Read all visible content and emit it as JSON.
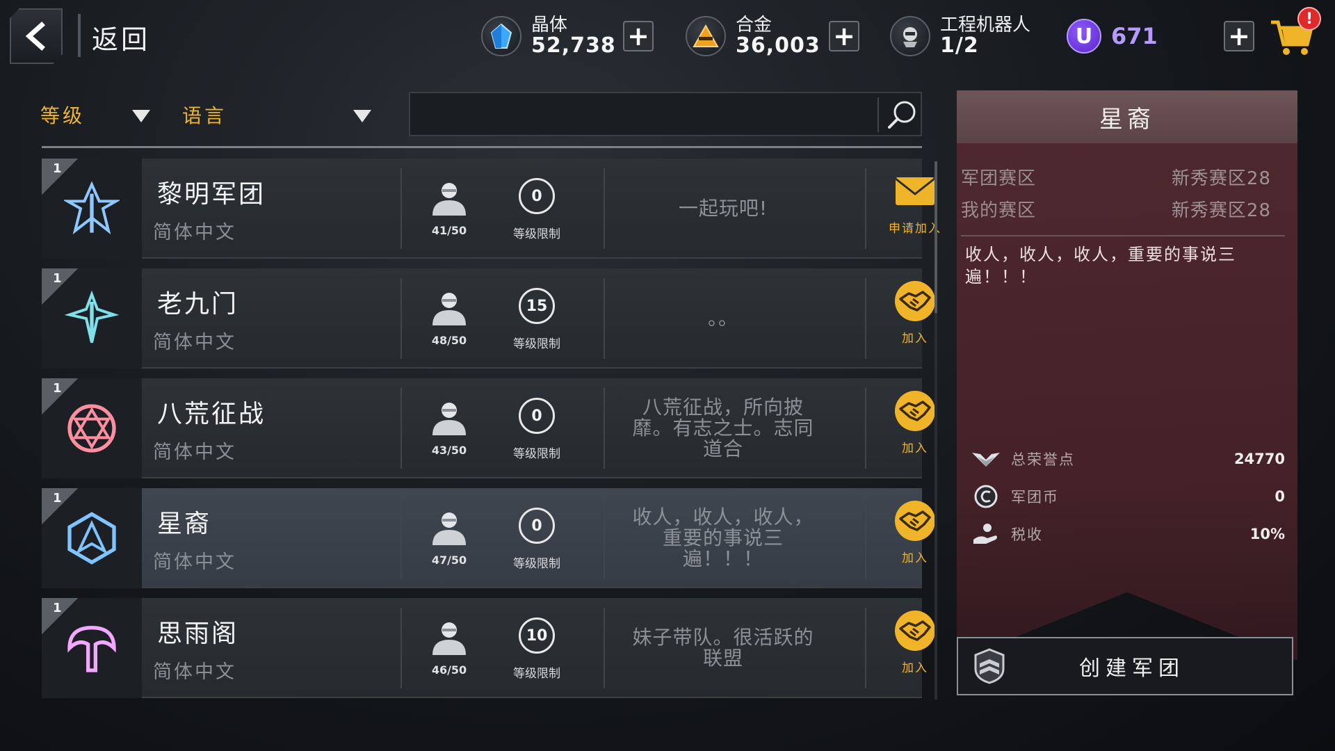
{
  "header": {
    "back_label": "返回",
    "resources": [
      {
        "name": "晶体",
        "value": "52,738",
        "icon": "crystal-icon"
      },
      {
        "name": "合金",
        "value": "36,003",
        "icon": "alloy-icon"
      },
      {
        "name": "工程机器人",
        "value": "1/2",
        "icon": "robot-icon"
      }
    ],
    "u_currency": {
      "symbol": "U",
      "value": "671"
    },
    "plus_label": "+",
    "cart_badge": "!"
  },
  "filters": {
    "level_label": "等级",
    "language_label": "语言",
    "search_value": ""
  },
  "legions": [
    {
      "rank": "1",
      "name": "黎明军团",
      "language": "简体中文",
      "members": "41/50",
      "level_req": "0",
      "level_req_label": "等级限制",
      "slogan": "一起玩吧!",
      "action": "申请加入",
      "action_type": "apply",
      "emblem": "dawn-emblem-icon",
      "emblem_color": "#8fc8ff"
    },
    {
      "rank": "1",
      "name": "老九门",
      "language": "简体中文",
      "members": "48/50",
      "level_req": "15",
      "level_req_label": "等级限制",
      "slogan": "。。",
      "action": "加入",
      "action_type": "join",
      "emblem": "nine-gates-emblem-icon",
      "emblem_color": "#7fe0ea"
    },
    {
      "rank": "1",
      "name": "八荒征战",
      "language": "简体中文",
      "members": "43/50",
      "level_req": "0",
      "level_req_label": "等级限制",
      "slogan": "八荒征战，所向披靡。有志之士。志同道合",
      "action": "加入",
      "action_type": "join",
      "emblem": "eight-wilds-emblem-icon",
      "emblem_color": "#ff8fa0"
    },
    {
      "rank": "1",
      "name": "星裔",
      "language": "简体中文",
      "members": "47/50",
      "level_req": "0",
      "level_req_label": "等级限制",
      "slogan": "收人，收人，收人，重要的事说三遍！！！",
      "action": "加入",
      "action_type": "join",
      "emblem": "star-descendant-emblem-icon",
      "emblem_color": "#7fc4ff",
      "selected": true
    },
    {
      "rank": "1",
      "name": "思雨阁",
      "language": "简体中文",
      "members": "46/50",
      "level_req": "10",
      "level_req_label": "等级限制",
      "slogan": "妹子带队。很活跃的联盟",
      "action": "加入",
      "action_type": "join",
      "emblem": "rain-pavilion-emblem-icon",
      "emblem_color": "#f2a8ff"
    }
  ],
  "detail": {
    "title": "星裔",
    "legion_zone_label": "军团赛区",
    "legion_zone_value": "新秀赛区28",
    "my_zone_label": "我的赛区",
    "my_zone_value": "新秀赛区28",
    "description": "收人，收人，收人，重要的事说三遍！！！",
    "stats": [
      {
        "label": "总荣誉点",
        "value": "24770",
        "icon": "honor-wings-icon"
      },
      {
        "label": "军团币",
        "value": "0",
        "icon": "legion-coin-icon"
      },
      {
        "label": "税收",
        "value": "10%",
        "icon": "tax-icon"
      }
    ]
  },
  "create_button": {
    "label": "创建军团"
  },
  "colors": {
    "accent": "#f0b428",
    "panel": "#52282f",
    "purple": "#7a3cf0"
  }
}
